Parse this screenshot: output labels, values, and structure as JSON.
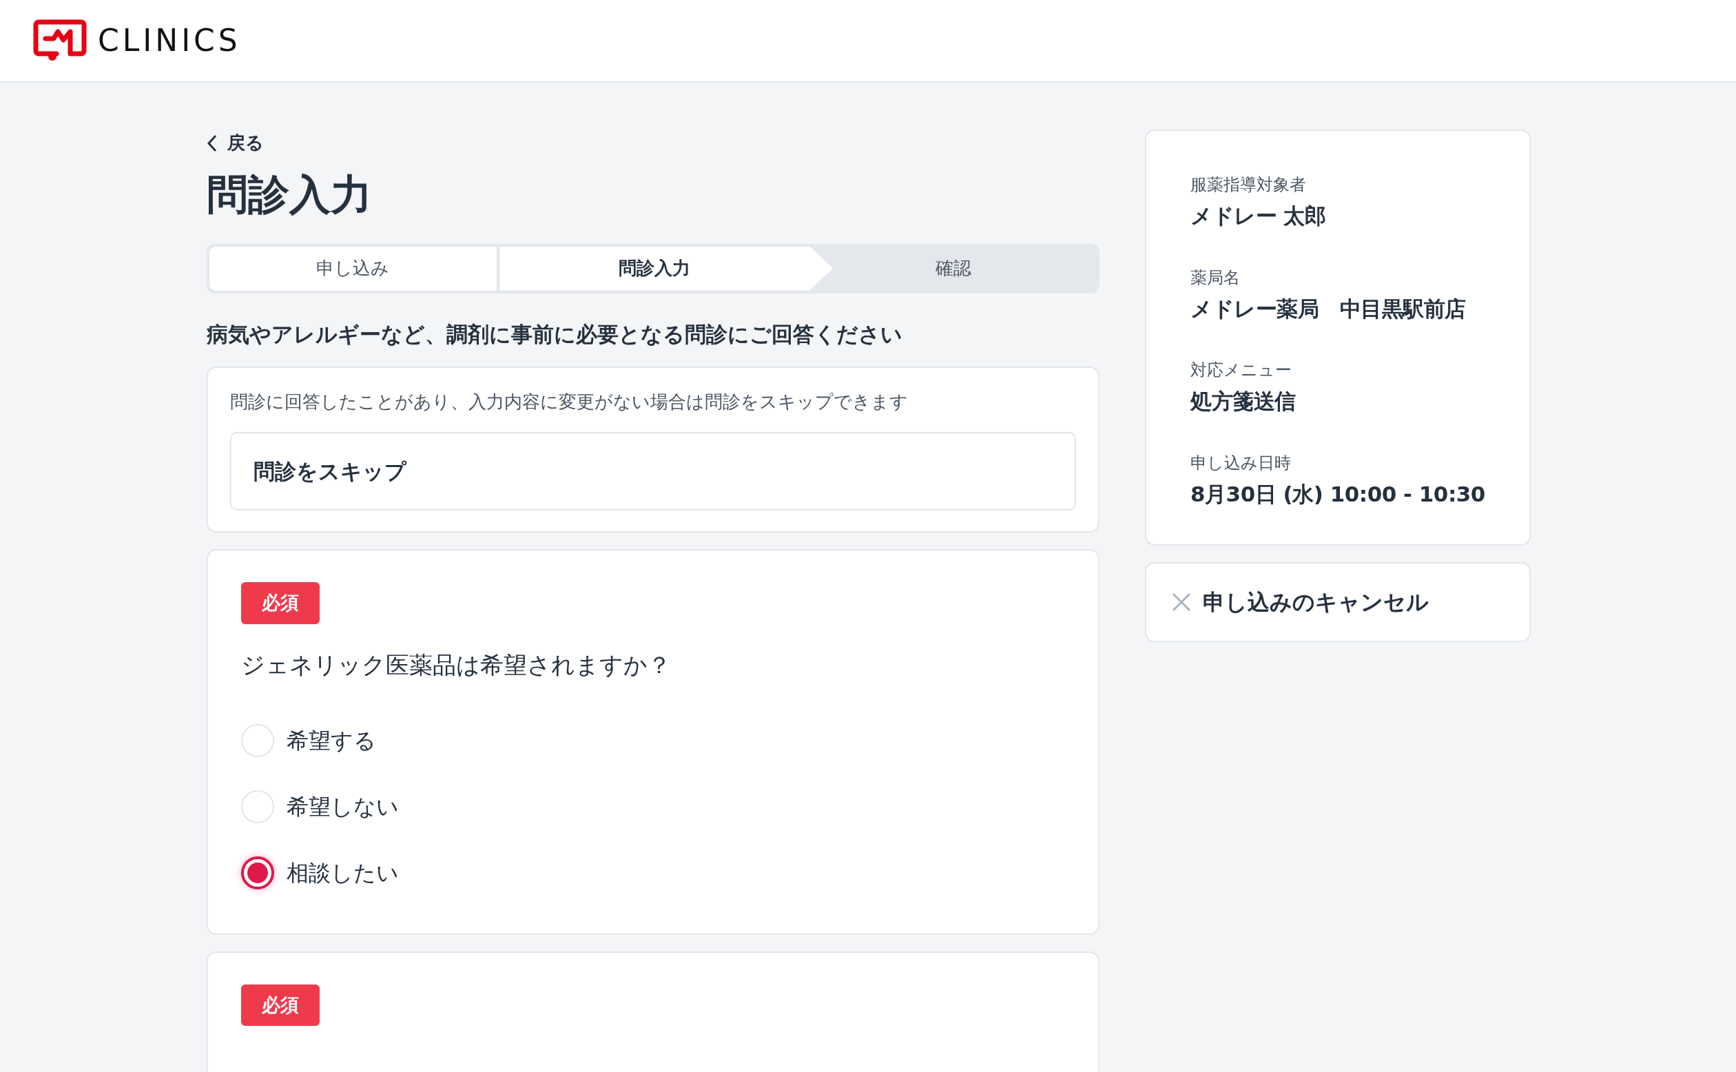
{
  "header": {
    "logo_text": "CLINICS"
  },
  "back_link": "戻る",
  "title": "問診入力",
  "steps": [
    {
      "label": "申し込み",
      "selected": false,
      "completed": true
    },
    {
      "label": "問診入力",
      "selected": true,
      "completed": false
    },
    {
      "label": "確認",
      "selected": false,
      "completed": false
    }
  ],
  "instruction": "病気やアレルギーなど、調剤に事前に必要となる問診にご回答ください",
  "skip_card": {
    "note": "問診に回答したことがあり、入力内容に変更がない場合は問診をスキップできます",
    "button": "問診をスキップ"
  },
  "questions": [
    {
      "badge": "必須",
      "text": "ジェネリック医薬品は希望されますか？",
      "options": [
        {
          "label": "希望する",
          "selected": false
        },
        {
          "label": "希望しない",
          "selected": false
        },
        {
          "label": "相談したい",
          "selected": true
        }
      ]
    },
    {
      "badge": "必須"
    }
  ],
  "summary": [
    {
      "label": "服薬指導対象者",
      "value": "メドレー 太郎"
    },
    {
      "label": "薬局名",
      "value": "メドレー薬局　中目黒駅前店"
    },
    {
      "label": "対応メニュー",
      "value": "処方箋送信"
    },
    {
      "label": "申し込み日時",
      "value": "8月30日 (水) 10:00 - 10:30"
    }
  ],
  "cancel_button": "申し込みのキャンセル"
}
